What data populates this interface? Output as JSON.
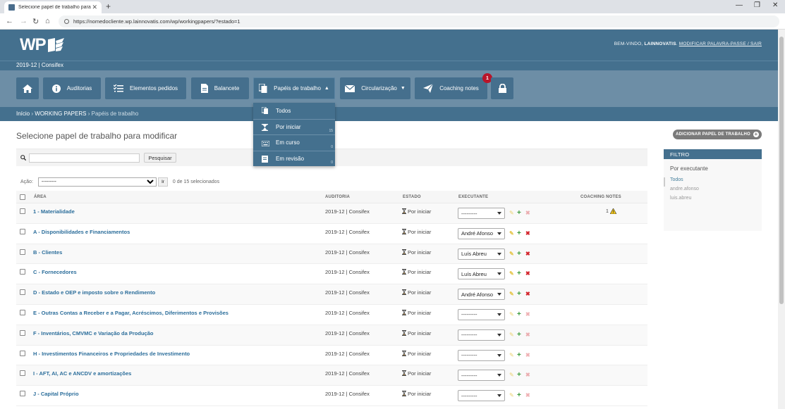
{
  "browser": {
    "tab_title": "Selecione papel de trabalho para",
    "url": "https://nomedocliente.wp.lainnovatis.com/wp/workingpapers/?estado=1"
  },
  "header": {
    "logo": "WP",
    "welcome_prefix": "BEM-VINDO,",
    "user": "LAINNOVATIS",
    "links": "MODIFICAR PALAVRA-PASSE / SAIR",
    "subtitle": "2019-12 | Consifex"
  },
  "nav": {
    "auditorias": "Auditorias",
    "elementos": "Elementos pedidos",
    "balancete": "Balancete",
    "papeis": "Papéis de trabalho",
    "circularizacao": "Circularização",
    "coaching": "Coaching notes",
    "coaching_badge": "1"
  },
  "dropdown": [
    {
      "label": "Todos",
      "count": ""
    },
    {
      "label": "Por iniciar",
      "count": "15"
    },
    {
      "label": "Em curso",
      "count": "0"
    },
    {
      "label": "Em revisão",
      "count": "0"
    }
  ],
  "breadcrumbs": {
    "home": "Início",
    "section": "WORKING PAPERS",
    "current": "Papéis de trabalho",
    "sep": "›"
  },
  "page": {
    "title": "Selecione papel de trabalho para modificar",
    "add_button": "ADICIONAR PAPEL DE TRABALHO",
    "search_button": "Pesquisar",
    "action_label": "Ação:",
    "action_placeholder": "---------",
    "go_button": "Ir",
    "selected_count": "0 de 15 selecionados"
  },
  "table": {
    "headers": {
      "area": "ÁREA",
      "auditoria": "AUDITORIA",
      "estado": "ESTADO",
      "executante": "EXECUTANTE",
      "coaching": "COACHING NOTES"
    },
    "rows": [
      {
        "area": "1 - Materialidade",
        "auditoria": "2019-12 | Consifex",
        "estado": "Por iniciar",
        "executante": "---------",
        "assigned": false,
        "coaching": "1"
      },
      {
        "area": "A - Disponibilidades e Financiamentos",
        "auditoria": "2019-12 | Consifex",
        "estado": "Por iniciar",
        "executante": "André Afonso",
        "assigned": true,
        "coaching": ""
      },
      {
        "area": "B - Clientes",
        "auditoria": "2019-12 | Consifex",
        "estado": "Por iniciar",
        "executante": "Luís Abreu",
        "assigned": true,
        "coaching": ""
      },
      {
        "area": "C - Fornecedores",
        "auditoria": "2019-12 | Consifex",
        "estado": "Por iniciar",
        "executante": "Luís Abreu",
        "assigned": true,
        "coaching": ""
      },
      {
        "area": "D - Estado e OEP e imposto sobre o Rendimento",
        "auditoria": "2019-12 | Consifex",
        "estado": "Por iniciar",
        "executante": "André Afonso",
        "assigned": true,
        "coaching": ""
      },
      {
        "area": "E - Outras Contas a Receber e a Pagar, Acréscimos, Diferimentos e Provisões",
        "auditoria": "2019-12 | Consifex",
        "estado": "Por iniciar",
        "executante": "---------",
        "assigned": false,
        "coaching": ""
      },
      {
        "area": "F - Inventários, CMVMC e Variação da Produção",
        "auditoria": "2019-12 | Consifex",
        "estado": "Por iniciar",
        "executante": "---------",
        "assigned": false,
        "coaching": ""
      },
      {
        "area": "H - Investimentos Financeiros e Propriedades de Investimento",
        "auditoria": "2019-12 | Consifex",
        "estado": "Por iniciar",
        "executante": "---------",
        "assigned": false,
        "coaching": ""
      },
      {
        "area": "I - AFT, AI, AC e ANCDV e amortizações",
        "auditoria": "2019-12 | Consifex",
        "estado": "Por iniciar",
        "executante": "---------",
        "assigned": false,
        "coaching": ""
      },
      {
        "area": "J - Capital Próprio",
        "auditoria": "2019-12 | Consifex",
        "estado": "Por iniciar",
        "executante": "---------",
        "assigned": false,
        "coaching": ""
      }
    ]
  },
  "filter": {
    "title": "FILTRO",
    "by": "Por executante",
    "options": [
      "Todos",
      "andre.afonso",
      "luis.abreu"
    ]
  },
  "colors": {
    "primary": "#44708e",
    "navbar": "#6d8ea6",
    "link": "#2c6e9b",
    "danger": "#d3232a",
    "success": "#3a9a3a"
  }
}
